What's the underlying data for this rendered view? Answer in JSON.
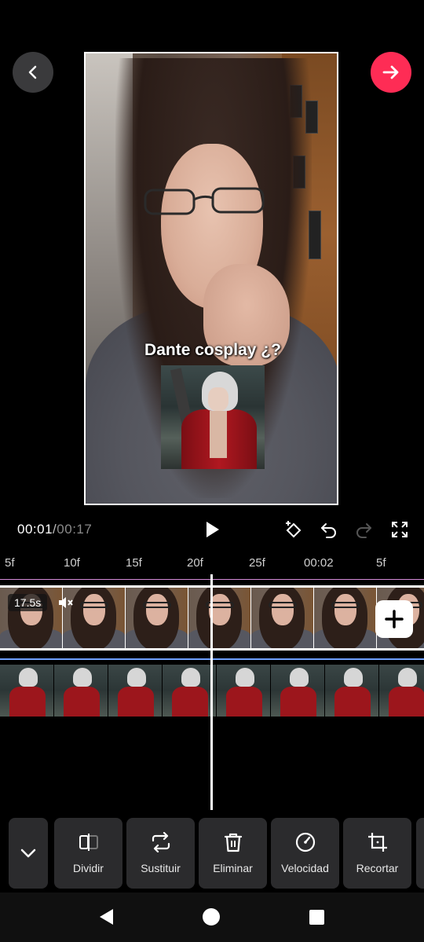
{
  "header": {
    "back_icon": "chevron-left-icon",
    "next_icon": "arrow-right-icon",
    "next_color": "#fe2c55"
  },
  "preview": {
    "caption": "Dante cosplay ¿?"
  },
  "playback": {
    "current_time": "00:01",
    "separator": "/",
    "total_time": "00:17",
    "icons": [
      "play-icon",
      "keyframe-icon",
      "undo-icon",
      "redo-icon",
      "fullscreen-icon"
    ]
  },
  "ruler": {
    "labels": [
      "5f",
      "10f",
      "15f",
      "20f",
      "25f",
      "00:02",
      "5f"
    ]
  },
  "timeline": {
    "main_clip_duration": "17.5s",
    "main_track_color": "#d48bd8",
    "overlay_track_color": "#6fa0ff"
  },
  "toolbar": {
    "items": [
      {
        "label": "Dividir",
        "icon": "split-icon"
      },
      {
        "label": "Sustituir",
        "icon": "replace-icon"
      },
      {
        "label": "Eliminar",
        "icon": "trash-icon"
      },
      {
        "label": "Velocidad",
        "icon": "speed-icon"
      },
      {
        "label": "Recortar",
        "icon": "crop-icon"
      }
    ]
  },
  "navbar": {
    "icons": [
      "nav-back-icon",
      "nav-home-icon",
      "nav-recents-icon"
    ]
  }
}
